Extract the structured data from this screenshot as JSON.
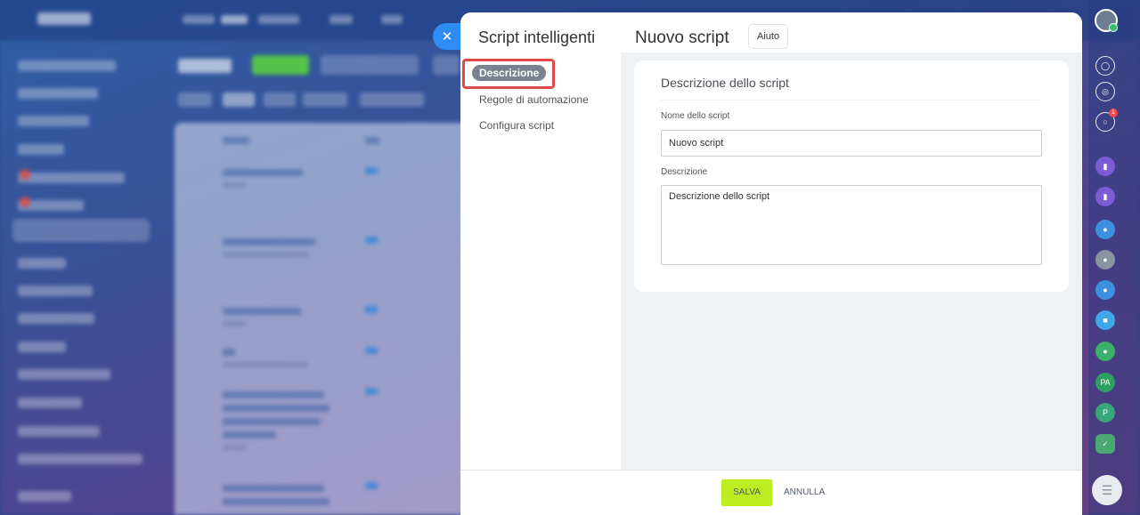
{
  "panel": {
    "left_title": "Script intelligenti",
    "nav": [
      {
        "label": "Descrizione",
        "active": true
      },
      {
        "label": "Regole di automazione",
        "active": false
      },
      {
        "label": "Configura script",
        "active": false
      }
    ],
    "header_title": "Nuovo script",
    "help_label": "Aiuto",
    "card": {
      "title": "Descrizione dello script",
      "name_label": "Nome dello script",
      "name_value": "Nuovo script",
      "description_label": "Descrizione",
      "description_value": "Descrizione dello script"
    },
    "footer": {
      "save_label": "SALVA",
      "cancel_label": "ANNULLA"
    }
  },
  "close_icon": "close-icon",
  "right_strip": {
    "badge_count": "1",
    "initials": [
      "PA",
      "P"
    ]
  },
  "colors": {
    "accent": "#bbed21",
    "highlight": "#e04a48",
    "close_button": "#2f8cf4",
    "active_nav": "#7a8290"
  }
}
